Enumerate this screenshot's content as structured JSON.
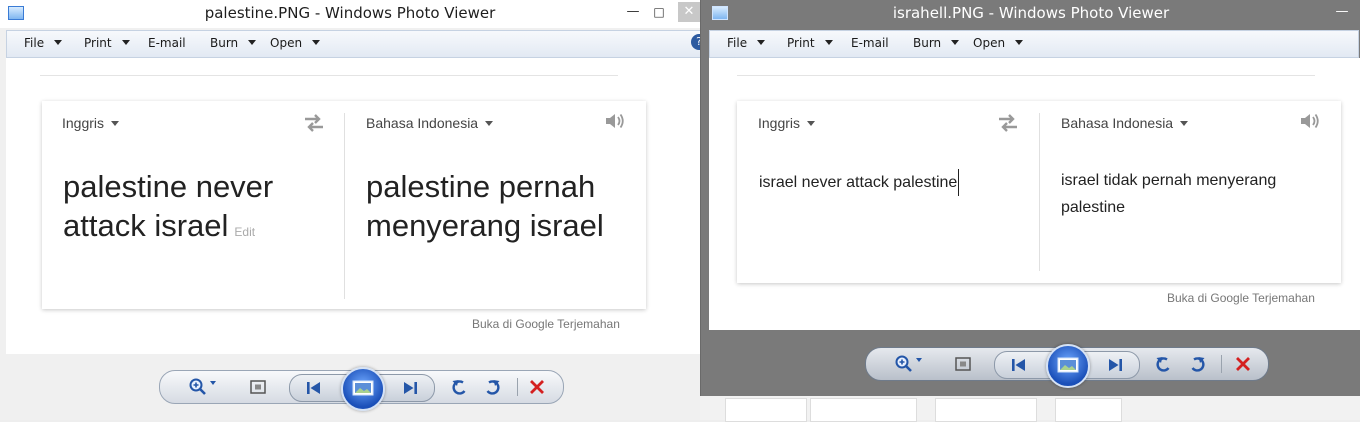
{
  "left_window": {
    "title": "palestine.PNG - Windows Photo Viewer",
    "menu": [
      "File",
      "Print",
      "E-mail",
      "Burn",
      "Open"
    ],
    "source_lang": "Inggris",
    "target_lang": "Bahasa Indonesia",
    "source_text": "palestine never attack israel",
    "edit_label": "Edit",
    "translation": "palestine pernah menyerang israel",
    "open_in_translate": "Buka di Google Terjemahan"
  },
  "right_window": {
    "title": "israhell.PNG - Windows Photo Viewer",
    "menu": [
      "File",
      "Print",
      "E-mail",
      "Burn",
      "Open"
    ],
    "source_lang": "Inggris",
    "target_lang": "Bahasa Indonesia",
    "source_text": "israel never attack palestine",
    "translation": "israel tidak pernah menyerang palestine",
    "open_in_translate": "Buka di Google Terjemahan"
  },
  "colors": {
    "accent_blue": "#1a4fb8",
    "delete_red": "#d42020",
    "inactive_titlebar": "#7a7a7a"
  },
  "icons": [
    "app-icon",
    "swap-languages-icon",
    "speaker-icon",
    "zoom-icon",
    "actual-size-icon",
    "previous-icon",
    "slideshow-icon",
    "next-icon",
    "rotate-left-icon",
    "rotate-right-icon",
    "delete-icon",
    "help-icon"
  ]
}
